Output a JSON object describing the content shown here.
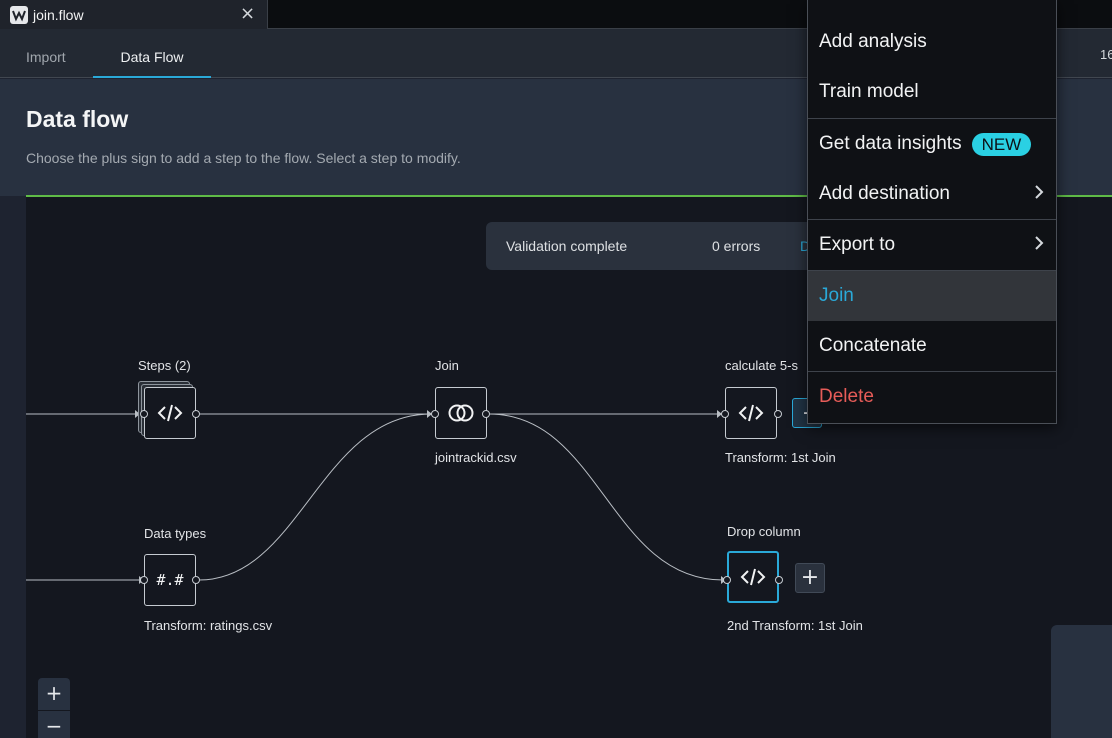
{
  "file_tab": {
    "name": "join.flow",
    "close_symbol": "×"
  },
  "view_tabs": [
    {
      "label": "Import"
    },
    {
      "label": "Data Flow"
    }
  ],
  "right_cutoff_text": "16",
  "page": {
    "title": "Data flow",
    "subtitle": "Choose the plus sign to add a step to the flow. Select a step to modify."
  },
  "validation": {
    "status": "Validation complete",
    "errors": "0 errors",
    "link_fragment": "D"
  },
  "nodes": {
    "steps": {
      "label": "Steps (2)",
      "icon": "code-icon"
    },
    "data_types": {
      "label": "Data types",
      "glyph": "#.#",
      "caption": "Transform: ratings.csv"
    },
    "join": {
      "label": "Join",
      "icon": "join-icon",
      "caption": "jointrackid.csv"
    },
    "calculate": {
      "label": "calculate 5-s",
      "icon": "code-icon",
      "caption": "Transform: 1st Join"
    },
    "drop_column": {
      "label": "Drop column",
      "icon": "code-icon",
      "caption": "2nd Transform: 1st Join"
    }
  },
  "controls": {
    "add_step": "+",
    "add_step_partial": "-",
    "zoom_in": "+",
    "zoom_out": "−"
  },
  "context_menu": {
    "items": [
      {
        "label": "Add analysis"
      },
      {
        "label": "Train model"
      },
      {
        "label": "Get data insights",
        "badge": "NEW"
      },
      {
        "label": "Add destination",
        "has_submenu": true
      },
      {
        "label": "Export to",
        "has_submenu": true
      },
      {
        "label": "Join",
        "highlighted": true
      },
      {
        "label": "Concatenate"
      },
      {
        "label": "Delete",
        "destructive": true
      }
    ]
  },
  "colors": {
    "accent": "#2aa9d8",
    "success": "#5fbb47",
    "danger": "#e65c58",
    "badge": "#2ad0e3"
  }
}
